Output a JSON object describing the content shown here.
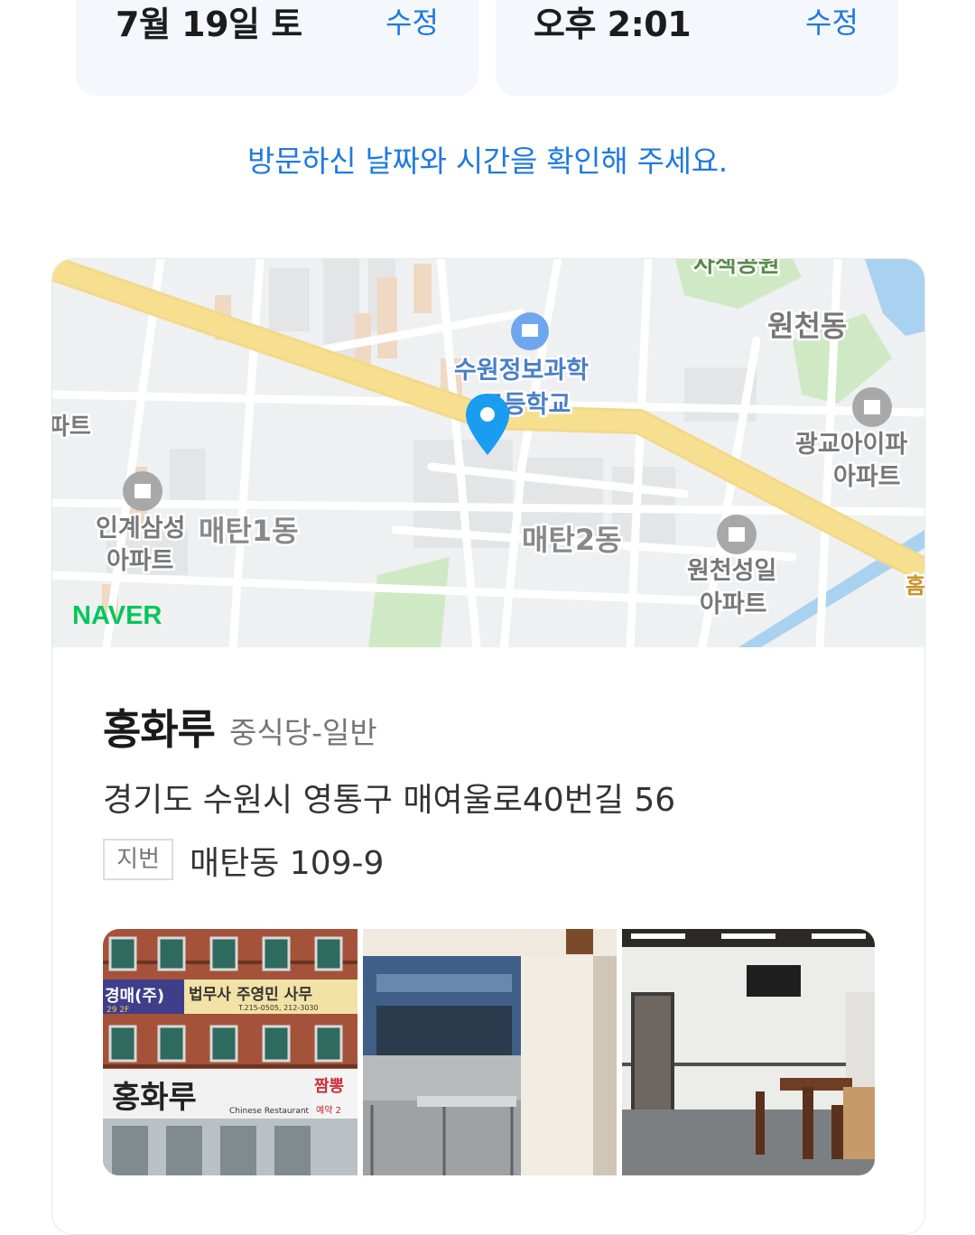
{
  "visit": {
    "date": "7월 19일 토",
    "time": "오후 2:01",
    "edit_label": "수정",
    "notice": "방문하신 날짜와 시간을 확인해 주세요."
  },
  "map": {
    "brand": "NAVER",
    "labels": {
      "park": "사색공원",
      "wonchun": "원천동",
      "school_line1": "수원정보과학",
      "school_line2": "고등학교",
      "apt_left": "파트",
      "gwanggyo_line1": "광교아이파",
      "gwanggyo_line2": "아파트",
      "ingye_line1": "인계삼성",
      "ingye_line2": "아파트",
      "maetan1": "매탄1동",
      "maetan2": "매탄2동",
      "wonchun_sungil_line1": "원천성일",
      "wonchun_sungil_line2": "아파트",
      "edge_right": "홈"
    }
  },
  "place": {
    "name": "홍화루",
    "category": "중식당-일반",
    "road_address": "경기도 수원시 영통구 매여울로40번길 56",
    "jibun_label": "지번",
    "jibun_address": "매탄동 109-9"
  },
  "photos": {
    "sign_text": "홍화루",
    "sign_sub": "Chinese Restaurant",
    "sign_right": "짬뽕",
    "sign_reserve": "예약 2",
    "banner_left": "경매(주)",
    "banner_mid": "법무사 주영민 사무",
    "banner_floor": "29 2F",
    "banner_phone": "T.215-0505, 212-3030"
  },
  "colors": {
    "accent": "#1f7ae0",
    "naver_green": "#03c75a",
    "road_yellow": "#f6e08f"
  }
}
